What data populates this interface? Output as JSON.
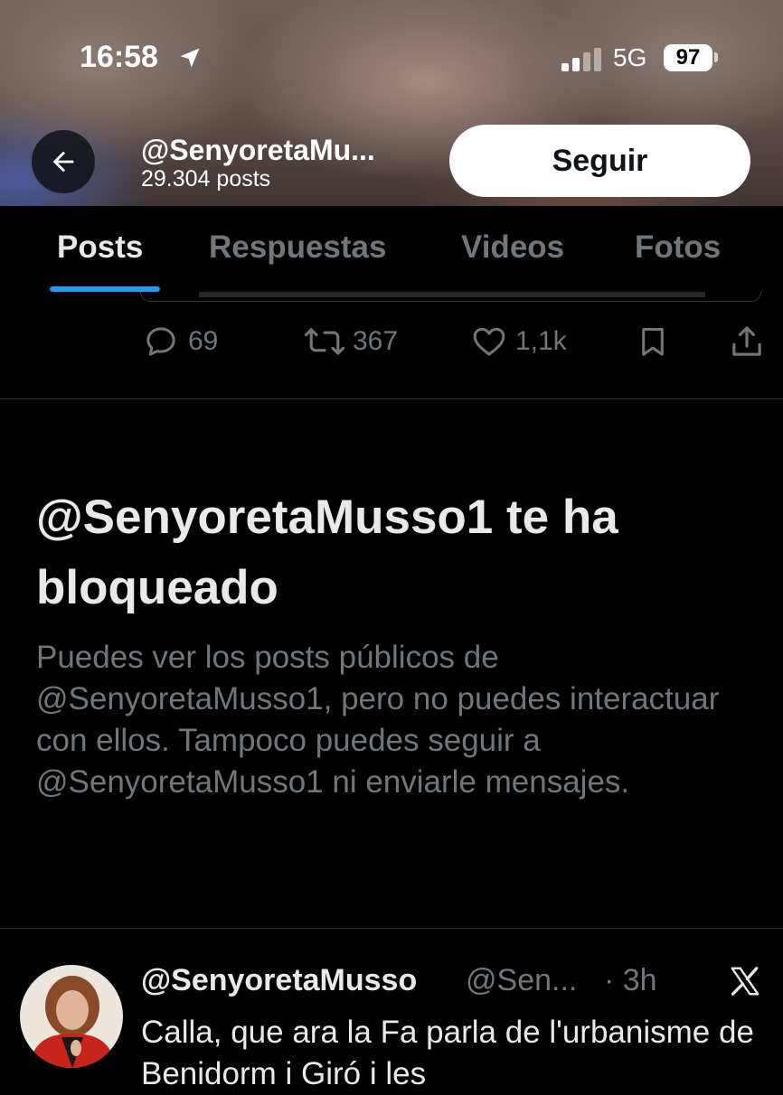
{
  "status_bar": {
    "time": "16:58",
    "network": "5G",
    "battery": "97"
  },
  "header": {
    "profile_name": "@SenyoretaMu...",
    "post_count": "29.304 posts",
    "follow_label": "Seguir"
  },
  "tabs": [
    {
      "label": "Posts",
      "active": true
    },
    {
      "label": "Respuestas",
      "active": false
    },
    {
      "label": "Videos",
      "active": false
    },
    {
      "label": "Fotos",
      "active": false
    }
  ],
  "post_actions": {
    "replies": "69",
    "reposts": "367",
    "likes": "1,1k"
  },
  "blocked_notice": {
    "title": "@SenyoretaMusso1 te ha bloqueado",
    "description": "Puedes ver los posts públicos de @SenyoretaMusso1, pero no puedes interactuar con ellos. Tampoco puedes seguir a @SenyoretaMusso1 ni enviarle mensajes."
  },
  "tweet": {
    "name": "@SenyoretaMusso",
    "handle": "@Sen...",
    "time": "· 3h",
    "text": "Calla, que ara la Fa parla de l'urbanisme de Benidorm i Giró i les"
  },
  "colors": {
    "background": "#000000",
    "text_primary": "#e7e9ea",
    "text_secondary": "#71767b",
    "accent": "#1d9bf0",
    "divider": "#2f3336"
  }
}
